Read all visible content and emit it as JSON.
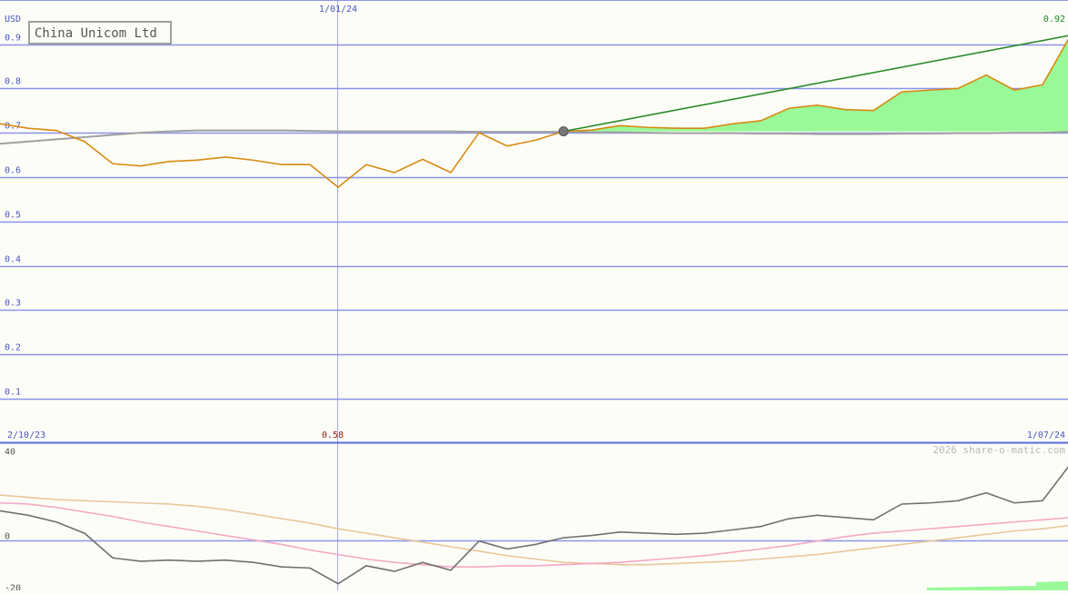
{
  "title": "China Unicom Ltd",
  "currency": "USD",
  "start_date": "2/10/23",
  "mid_date": "1/01/24",
  "end_date": "1/07/24",
  "low_marker": "0.58",
  "high_marker": "0.92",
  "watermark": "2026 share-o-matic.com",
  "colors": {
    "price": "#d88a12",
    "trend": "#2a8a2a",
    "gain_fill": "#99f999",
    "grid": "#8c94e8",
    "average": "#a0a0a0",
    "osc_main": "#707070",
    "osc_pink": "#f4a8c4",
    "osc_tan": "#e8c89a"
  },
  "chart_data": [
    {
      "type": "line",
      "ylabel": "USD",
      "ylim": [
        0.0,
        0.95
      ],
      "yticks": [
        "0.1",
        "0.2",
        "0.3",
        "0.4",
        "0.5",
        "0.6",
        "0.7",
        "0.8",
        "0.9"
      ],
      "ytick_values": [
        0.1,
        0.2,
        0.3,
        0.4,
        0.5,
        0.6,
        0.7,
        0.8,
        0.9
      ],
      "x": [
        0,
        1,
        2,
        3,
        4,
        5,
        6,
        7,
        8,
        9,
        10,
        11,
        12,
        13,
        14,
        15,
        16,
        17,
        18,
        19,
        20,
        21,
        22,
        23,
        24,
        25,
        26,
        27,
        28,
        29,
        30,
        31,
        32,
        33,
        34,
        35,
        36,
        37,
        38,
        39
      ],
      "series": [
        {
          "values": [
            0.72,
            0.71,
            0.705,
            0.68,
            0.63,
            0.625,
            0.635,
            0.638,
            0.645,
            0.638,
            0.628,
            0.628,
            0.577,
            0.628,
            0.61,
            0.64,
            0.61,
            0.7,
            0.67,
            0.683,
            0.703,
            0.706,
            0.716,
            0.712,
            0.71,
            0.71,
            0.72,
            0.727,
            0.755,
            0.762,
            0.752,
            0.75,
            0.792,
            0.796,
            0.8,
            0.83,
            0.796,
            0.808,
            0.92
          ]
        },
        {
          "values": [
            0.675,
            0.68,
            0.685,
            0.69,
            0.695,
            0.7,
            0.703,
            0.705,
            0.705,
            0.705,
            0.705,
            0.704,
            0.703,
            0.703,
            0.703,
            0.703,
            0.703,
            0.702,
            0.702,
            0.702,
            0.702,
            0.701,
            0.701,
            0.7,
            0.699,
            0.699,
            0.699,
            0.698,
            0.698,
            0.697,
            0.697,
            0.697,
            0.698,
            0.698,
            0.699,
            0.699,
            0.7,
            0.7,
            0.702
          ]
        }
      ],
      "trend_line": {
        "start_index": 20,
        "start_value": 0.703,
        "end_index": 38,
        "end_value": 0.92
      },
      "gain_baseline": 0.703,
      "reference_index": 12
    },
    {
      "type": "line",
      "ylim": [
        -20,
        40
      ],
      "yticks": [
        "40",
        "0",
        "-20"
      ],
      "ytick_values": [
        40,
        0,
        -20
      ],
      "series": [
        {
          "values": [
            13,
            11,
            8,
            3,
            -8,
            -9.5,
            -9,
            -9.5,
            -9,
            -10,
            -12,
            -12.5,
            -19.5,
            -11.5,
            -14,
            -10,
            -13.5,
            -0.5,
            -4,
            -2,
            1,
            2,
            3.5,
            3,
            2.5,
            3,
            4.5,
            6,
            9.5,
            11,
            10,
            9,
            16,
            16.5,
            17.5,
            21,
            16.5,
            17.5,
            34
          ]
        },
        {
          "values": [
            16.5,
            16,
            14.5,
            12.5,
            10.5,
            8,
            6,
            4,
            2,
            0,
            -2,
            -4.5,
            -6.5,
            -8.5,
            -10,
            -11,
            -12,
            -12,
            -11.5,
            -11.5,
            -11,
            -10.5,
            -10,
            -9,
            -8,
            -7,
            -5.5,
            -4,
            -2.5,
            -0.5,
            1.5,
            3,
            4,
            5,
            6,
            7,
            8,
            9,
            10,
            12.5
          ]
        },
        {
          "values": [
            20,
            19,
            18,
            17.5,
            17,
            16.5,
            16,
            15,
            13.5,
            11.5,
            9.5,
            7.5,
            5,
            3,
            1,
            -1,
            -3,
            -5,
            -7,
            -8.5,
            -10,
            -10.5,
            -11,
            -11,
            -10.5,
            -10,
            -9.5,
            -8.5,
            -7.5,
            -6.5,
            -5,
            -3.5,
            -2,
            -0.5,
            1,
            2.5,
            4,
            5,
            6.5,
            8.5
          ]
        }
      ]
    }
  ]
}
